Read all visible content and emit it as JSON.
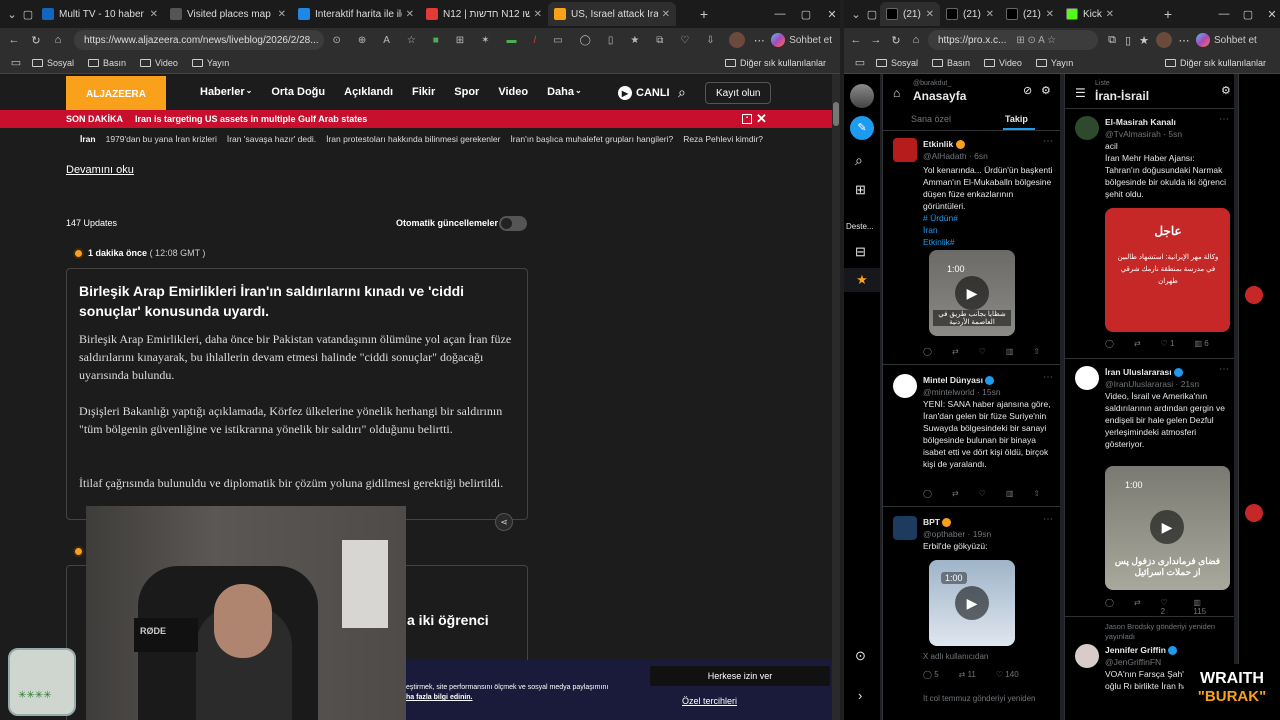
{
  "left_browser": {
    "tabs": [
      {
        "label": "Multi TV - 10 haber k",
        "color": "#1565c0"
      },
      {
        "label": "Visited places map editor",
        "color": "#555"
      },
      {
        "label": "Interaktif harita ile ilgili sc",
        "color": "#1e88e5"
      },
      {
        "label": "N12 | חדשות N12 אתר החדשו",
        "color": "#e53935"
      },
      {
        "label": "US, Israel attack Iran live:",
        "color": "#f9a11b"
      }
    ],
    "url": "https://www.aljazeera.com/news/liveblog/2026/2/28...",
    "profile_label": "Sohbet et",
    "bookmarks": [
      "Sosyal",
      "Basın",
      "Video",
      "Yayın"
    ],
    "other_bookmarks": "Diğer sık kullanılanlar"
  },
  "aljazeera": {
    "logo": "ALJAZEERA",
    "menu": [
      "Haberler",
      "Orta Doğu",
      "Açıklandı",
      "Fikir",
      "Spor",
      "Video",
      "Daha"
    ],
    "live": "CANLI",
    "login": "Kayıt olun",
    "breaking_label": "SON DAKİKA",
    "breaking_text": "Iran is targeting US assets in multiple Gulf Arab states",
    "subnav": [
      "İran",
      "1979'dan bu yana İran krizleri",
      "İran 'savaşa hazır' dedi.",
      "İran protestoları hakkında bilinmesi gerekenler",
      "İran'ın başlıca muhalefet grupları hangileri?",
      "Reza Pehlevi kimdir?"
    ],
    "read_more": "Devamını oku",
    "updates": "147 Updates",
    "auto_updates": "Otomatik güncellemeler",
    "time_ago": "1 dakika önce",
    "time_stamp": "( 12:08 GMT )",
    "headline": "Birleşik Arap Emirlikleri İran'ın saldırılarını kınadı ve 'ciddi sonuçlar' konusunda uyardı.",
    "para1": "Birleşik Arap Emirlikleri, daha önce bir Pakistan vatandaşının ölümüne yol açan İran füze saldırılarını kınayarak, bu ihlallerin devam etmesi halinde \"ciddi sonuçlar\" doğacağı uyarısında bulundu.",
    "para2": "Dışişleri Bakanlığı yaptığı açıklamada, Körfez ülkelerine yönelik herhangi bir saldırının \"tüm bölgenin güvenliğine ve istikrarına yönelik bir saldırı\" olduğunu belirtti.",
    "para3": "İtilaf çağrısında bulunuldu ve diplomatik bir çözüm yoluna gidilmesi gerektiği belirtildi.",
    "next_headline_part": "a iki öğrenci",
    "cookie_text": "eştirmek, site performansını ölçmek ve sosyal medya paylaşımını",
    "cookie_link": "ha fazla bilgi edinin.",
    "allow_all": "Herkese izin ver",
    "prefs": "Özel tercihleri"
  },
  "right_browser": {
    "tabs": [
      "(21) X",
      "(21) X",
      "(21) I",
      "KickPr"
    ],
    "url": "https://pro.x.c...",
    "profile_label": "Sohbet et",
    "bookmarks": [
      "Sosyal",
      "Basın",
      "Video",
      "Yayın"
    ],
    "other_bookmarks": "Diğer sık kullanılanlar"
  },
  "xpro": {
    "nav_support": "Deste...",
    "home": {
      "user": "@burakdut_",
      "title": "Anasayfa",
      "tab_foryou": "Sana özel",
      "tab_following": "Takip",
      "posts": [
        {
          "name": "Etkinlik",
          "handle": "@AlHadath · 6sn",
          "text": "Yol kenarında... Ürdün'ün başkenti Amman'ın El-Mukaballn bölgesine düşen füze enkazlarının görüntüleri.",
          "tags": "# Ürdün#\nİran\nEtkinlik#",
          "video_time": "1:00",
          "video_caption": "شظايا بجانب طريق في العاصمة الأردنية"
        },
        {
          "name": "Mintel Dünyası",
          "handle": "@mintelworld · 15sn",
          "text": "YENİ: SANA haber ajansına göre, İran'dan gelen bir füze Suriye'nin Suwayda bölgesindeki bir sanayi bölgesinde bulunan bir binaya isabet etti ve dört kişi öldü, birçok kişi de yaralandı."
        },
        {
          "name": "BPT",
          "handle": "@opthaber · 19sn",
          "text": "Erbil'de gökyüzü:",
          "video_time": "1:00",
          "footer": "X adlı kullanıcıdan",
          "stats": [
            "5",
            "11",
            "140"
          ]
        }
      ],
      "more": "It col temmuz  gönderiyi yeniden"
    },
    "list": {
      "label": "Liste",
      "title": "İran-İsrail",
      "posts": [
        {
          "name": "El-Masirah Kanalı",
          "handle": "@TvAlmasirah · 5sn",
          "text": "acil\nİran Mehr Haber Ajansı: Tahran'ın doğusundaki Narmak bölgesinde bir okulda iki öğrenci şehit oldu.",
          "card_title": "عاجل",
          "card_text": "وكالة مهر الإيرانية: استشهاد طالبين في مدرسة بمنطقة نارمك شرقي طهران",
          "stats": [
            "1",
            "6"
          ]
        },
        {
          "name": "İran Uluslararası",
          "handle": "@IranUluslararasi · 21sn",
          "text": "Video, İsrail ve Amerika'nın saldırılarının ardından gergin ve endişeli bir hale gelen Dezful yerleşimindeki atmosferi gösteriyor.",
          "video_time": "1:00",
          "video_caption": "فضای فرمانداری دزفول پس از حملات اسرائیل",
          "stats": [
            "2",
            "115"
          ]
        },
        {
          "name": "Jennifer Griffin",
          "handle": "@JenGriffinFN",
          "reposted": "Jason Brodsky gönderiyi yeniden yayınladı",
          "text": "VOA'nın Farsça Şah'ın oğlu Rı birlikte İran ha"
        }
      ]
    }
  },
  "overlay": {
    "streamer_name": "WRAITH",
    "streamer_sub": "\"BURAK\"",
    "video_brand": "RØDE"
  }
}
